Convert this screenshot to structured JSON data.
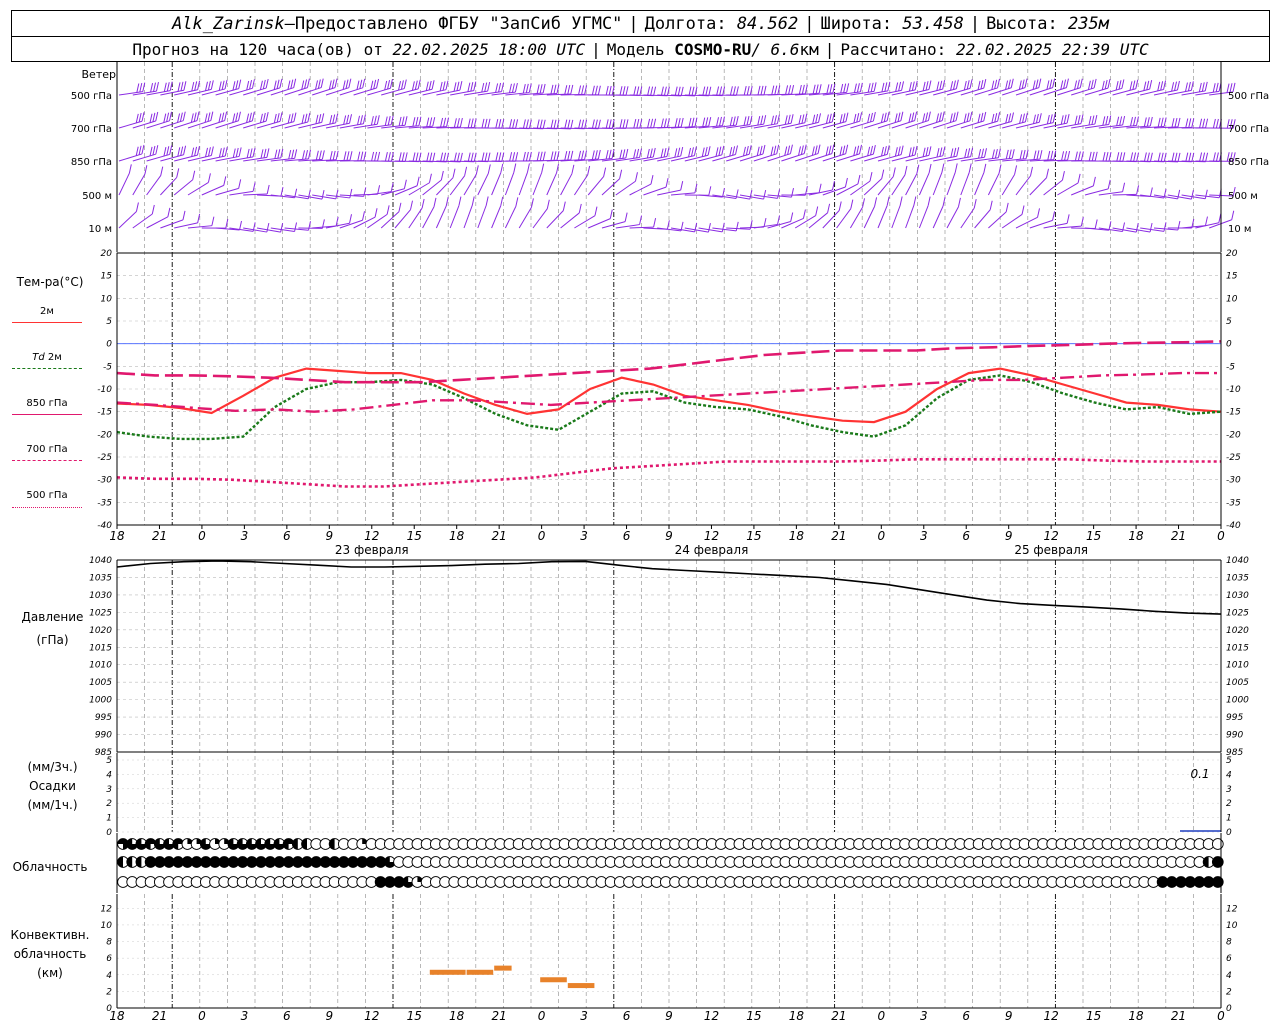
{
  "header": {
    "station": "Alk_Zarinsk",
    "dash": " – ",
    "provider": "Предоставлено ФГБУ \"ЗапСиб УГМС\"",
    "sep": "|",
    "lon_label": "Долгота:",
    "lon_value": "84.562",
    "lat_label": "Широта:",
    "lat_value": "53.458",
    "alt_label": "Высота:",
    "alt_value": "235м",
    "forecast_label": "Прогноз на 120 часа(ов) от",
    "forecast_start": "22.02.2025 18:00 UTC",
    "model_label": "Модель",
    "model_name": "COSMO-RU",
    "model_res": " / 6.6",
    "model_res_unit": "км",
    "calc_label": "Рассчитано:",
    "calc_time": "22.02.2025 22:39 UTC"
  },
  "wind_panel": {
    "title": "Ветер",
    "levels": [
      "500 гПа",
      "700 гПа",
      "850 гПа",
      "500 м",
      "10  м"
    ],
    "color": "#8a2be2"
  },
  "time_axis": {
    "hour_labels": [
      "18",
      "21",
      "0",
      "3",
      "6",
      "9",
      "12",
      "15",
      "18",
      "21",
      "0",
      "3",
      "6",
      "9",
      "12",
      "15",
      "18",
      "21",
      "0",
      "3",
      "6",
      "9",
      "12",
      "15",
      "18",
      "21",
      "0"
    ],
    "days": [
      "23 февраля",
      "24 февраля",
      "25 февраля"
    ]
  },
  "legend": {
    "temp_title": "Тем-ра(°С)",
    "t2m": "2м",
    "td_prefix": "Td",
    "td_suffix": "2м",
    "t850": "850 гПа",
    "t700": "700 гПа",
    "t500": "500 гПа",
    "pressure_title": "Давление",
    "pressure_unit": "(гПа)",
    "precip_unit_top": "(мм/3ч.)",
    "precip_title": "Осадки",
    "precip_unit_bottom": "(мм/1ч.)",
    "precip_max_label": "0.1",
    "cloud_title": "Облачность",
    "conv_title_1": "Конвективн.",
    "conv_title_2": "облачность",
    "conv_unit": "(км)"
  },
  "colors": {
    "t2m": "#ff3333",
    "td2m": "#1a7a1a",
    "t850": "#e0186e",
    "t700": "#e0186e",
    "t500": "#e0186e",
    "pressure": "#000000",
    "convective": "#e8822a",
    "precip": "#1f3fbf"
  },
  "chart_data": [
    {
      "type": "line",
      "title": "Тем-ра(°С)",
      "x_hours": [
        0,
        3,
        6,
        9,
        12,
        15,
        18,
        21,
        24,
        27,
        30,
        33,
        36,
        39,
        42,
        45,
        48,
        51,
        54,
        57,
        60,
        63,
        66,
        69,
        72,
        75,
        78,
        81,
        84,
        87,
        90,
        93,
        96,
        99,
        102,
        105,
        108,
        111,
        114,
        117,
        120
      ],
      "ylim": [
        -40,
        20
      ],
      "yticks": [
        20,
        15,
        10,
        5,
        0,
        -5,
        -10,
        -15,
        -20,
        -25,
        -30,
        -35,
        -40
      ],
      "series": [
        {
          "name": "2м",
          "key": "t2m",
          "values": [
            -13.2,
            -13.5,
            -14.2,
            -15.3,
            -11.5,
            -7.5,
            -5.5,
            -6,
            -6.5,
            -6.5,
            -8,
            -11,
            -13.5,
            -15.5,
            -14.5,
            -10,
            -7.5,
            -9,
            -11.5,
            -12.5,
            -13.5,
            -15,
            -16,
            -17,
            -17.3,
            -15,
            -10,
            -6.5,
            -5.5,
            -7,
            -9,
            -11,
            -13,
            -13.5,
            -14.5,
            -15
          ]
        },
        {
          "name": "Td 2м",
          "key": "td2m",
          "values": [
            -19.5,
            -20.5,
            -21,
            -21,
            -20.5,
            -14,
            -10,
            -8.5,
            -8.5,
            -8,
            -9,
            -12,
            -15.5,
            -18,
            -19,
            -15,
            -11,
            -10.5,
            -13,
            -14,
            -14.5,
            -16,
            -18,
            -19.5,
            -20.5,
            -18,
            -12,
            -8,
            -7,
            -8.5,
            -11,
            -13,
            -14.5,
            -14,
            -15.5,
            -15
          ]
        },
        {
          "name": "850 гПа",
          "key": "t850",
          "values": [
            -13,
            -13.5,
            -14.2,
            -14.8,
            -14.5,
            -15,
            -14.5,
            -13.5,
            -12.5,
            -12.5,
            -13,
            -13.5,
            -13,
            -12.5,
            -12,
            -11.5,
            -11,
            -10.5,
            -10,
            -9.5,
            -9,
            -8.5,
            -8,
            -8,
            -7.5,
            -7,
            -6.8,
            -6.5,
            -6.5
          ]
        },
        {
          "name": "700 гПа",
          "key": "t700",
          "values": [
            -6.5,
            -7,
            -7,
            -7.2,
            -7.5,
            -8,
            -8.5,
            -8.5,
            -8.5,
            -8,
            -7.5,
            -7,
            -6.5,
            -6,
            -5.5,
            -4.5,
            -3.5,
            -2.5,
            -2,
            -1.5,
            -1.5,
            -1.5,
            -1,
            -0.8,
            -0.5,
            -0.3,
            0,
            0.2,
            0.3,
            0.5
          ]
        },
        {
          "name": "500 гПа",
          "key": "t500",
          "values": [
            -29.5,
            -29.8,
            -29.8,
            -30,
            -30.5,
            -31,
            -31.5,
            -31.5,
            -31,
            -30.5,
            -30,
            -29.5,
            -28.5,
            -27.5,
            -27,
            -26.5,
            -26,
            -26,
            -26,
            -26,
            -25.8,
            -25.5,
            -25.5,
            -25.5,
            -25.5,
            -25.5,
            -25.8,
            -26,
            -26,
            -26
          ]
        }
      ]
    },
    {
      "type": "line",
      "title": "Давление",
      "ylim": [
        985,
        1040
      ],
      "yticks": [
        1040,
        1035,
        1030,
        1025,
        1020,
        1015,
        1010,
        1005,
        1000,
        995,
        990,
        985
      ],
      "series": [
        {
          "name": "Давление",
          "values": [
            1038,
            1039,
            1039.5,
            1039.7,
            1039.5,
            1039,
            1038.5,
            1038,
            1038,
            1038.2,
            1038.4,
            1038.8,
            1039,
            1039.5,
            1039.6,
            1038.5,
            1037.5,
            1037,
            1036.5,
            1036,
            1035.5,
            1035,
            1034,
            1033,
            1031.5,
            1030,
            1028.5,
            1027.5,
            1027,
            1026.5,
            1026,
            1025.3,
            1024.8,
            1024.5
          ]
        }
      ]
    },
    {
      "type": "bar",
      "title": "Осадки",
      "ylim": [
        0,
        5
      ],
      "yticks": [
        5,
        4,
        3,
        2,
        1,
        0
      ],
      "values_note": "",
      "max_label": "0.1"
    },
    {
      "type": "bar",
      "title": "Конвективн. облачность",
      "ylim": [
        0,
        13
      ],
      "yticks": [
        12,
        10,
        8,
        6,
        4,
        2,
        0
      ],
      "segments": [
        {
          "start": 34,
          "end": 38,
          "value": 4.3
        },
        {
          "start": 38,
          "end": 41,
          "value": 4.3
        },
        {
          "start": 41,
          "end": 43,
          "value": 4.8
        },
        {
          "start": 46,
          "end": 49,
          "value": 3.4
        },
        {
          "start": 49,
          "end": 52,
          "value": 2.7
        }
      ]
    }
  ],
  "clouds": {
    "high": [
      "ne",
      "tq",
      "tq",
      "fl",
      "tq",
      "tq",
      "fl",
      "q",
      "q",
      "tq",
      "q",
      "q",
      "tq",
      "tq",
      "tq",
      "tq",
      "tq",
      "tq",
      "fl",
      "h",
      "h",
      "e",
      "e",
      "h",
      "e",
      "e",
      "q",
      "e",
      "e",
      "e",
      "e",
      "e",
      "e",
      "e",
      "e",
      "e",
      "e",
      "e",
      "e",
      "e",
      "e",
      "e",
      "e",
      "e",
      "e",
      "e",
      "e",
      "e",
      "e",
      "e",
      "e",
      "e",
      "e",
      "e",
      "e",
      "e",
      "e",
      "e",
      "e",
      "e",
      "e",
      "e",
      "e",
      "e",
      "e",
      "e",
      "e",
      "e",
      "e",
      "e",
      "e",
      "e",
      "e",
      "e",
      "e",
      "e",
      "e",
      "e",
      "e",
      "e",
      "e",
      "e",
      "e",
      "e",
      "e",
      "e",
      "e",
      "e",
      "e",
      "e",
      "e",
      "e",
      "e",
      "e",
      "e",
      "e",
      "e",
      "e",
      "e",
      "e",
      "e",
      "e",
      "e",
      "e",
      "e",
      "e",
      "e",
      "e",
      "e",
      "e",
      "e",
      "e",
      "e",
      "e",
      "e",
      "e",
      "e",
      "e",
      "e",
      "e",
      "e"
    ],
    "middle": [
      "h",
      "h",
      "h",
      "f",
      "f",
      "f",
      "f",
      "f",
      "f",
      "f",
      "f",
      "f",
      "f",
      "f",
      "f",
      "f",
      "f",
      "f",
      "f",
      "f",
      "f",
      "f",
      "f",
      "f",
      "f",
      "f",
      "f",
      "f",
      "f",
      "tq",
      "e",
      "e",
      "e",
      "e",
      "e",
      "e",
      "e",
      "e",
      "e",
      "e",
      "e",
      "e",
      "e",
      "e",
      "e",
      "e",
      "e",
      "e",
      "e",
      "e",
      "e",
      "e",
      "e",
      "e",
      "e",
      "e",
      "e",
      "e",
      "e",
      "e",
      "e",
      "e",
      "e",
      "e",
      "e",
      "e",
      "e",
      "e",
      "e",
      "e",
      "e",
      "e",
      "e",
      "e",
      "e",
      "e",
      "e",
      "e",
      "e",
      "e",
      "e",
      "e",
      "e",
      "e",
      "e",
      "e",
      "e",
      "e",
      "e",
      "e",
      "e",
      "e",
      "e",
      "e",
      "e",
      "e",
      "e",
      "e",
      "e",
      "e",
      "e",
      "e",
      "e",
      "e",
      "e",
      "e",
      "e",
      "e",
      "e",
      "e",
      "e",
      "e",
      "e",
      "e",
      "e",
      "e",
      "e",
      "e",
      "h",
      "f"
    ],
    "low": [
      "e",
      "e",
      "e",
      "e",
      "e",
      "e",
      "e",
      "e",
      "e",
      "e",
      "e",
      "e",
      "e",
      "e",
      "e",
      "e",
      "e",
      "e",
      "e",
      "e",
      "e",
      "e",
      "e",
      "e",
      "e",
      "e",
      "e",
      "e",
      "f",
      "f",
      "f",
      "tq",
      "q",
      "e",
      "e",
      "e",
      "e",
      "e",
      "e",
      "e",
      "e",
      "e",
      "e",
      "e",
      "e",
      "e",
      "e",
      "e",
      "e",
      "e",
      "e",
      "e",
      "e",
      "e",
      "e",
      "e",
      "e",
      "e",
      "e",
      "e",
      "e",
      "e",
      "e",
      "e",
      "e",
      "e",
      "e",
      "e",
      "e",
      "e",
      "e",
      "e",
      "e",
      "e",
      "e",
      "e",
      "e",
      "e",
      "e",
      "e",
      "e",
      "e",
      "e",
      "e",
      "e",
      "e",
      "e",
      "e",
      "e",
      "e",
      "e",
      "e",
      "e",
      "e",
      "e",
      "e",
      "e",
      "e",
      "e",
      "e",
      "e",
      "e",
      "e",
      "e",
      "e",
      "e",
      "e",
      "e",
      "e",
      "e",
      "e",
      "e",
      "e",
      "f",
      "f",
      "f",
      "f",
      "f",
      "f",
      "f"
    ]
  }
}
